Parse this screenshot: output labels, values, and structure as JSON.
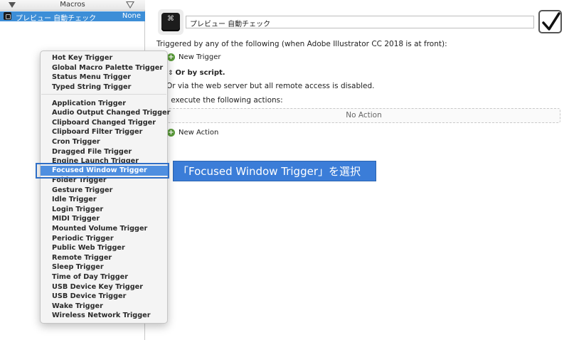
{
  "sidebar": {
    "header_title": "Macros",
    "macro": {
      "name": "プレビュー 自動チェック",
      "badge": "None"
    }
  },
  "editor": {
    "macro_name": "プレビュー 自動チェック",
    "macro_icon_glyph": "⌘",
    "enabled_checked": true,
    "triggered_label": "Triggered by any of the following (when Adobe Illustrator CC 2018 is at front):",
    "new_trigger": "New Trigger",
    "or_by_script": "Or by script.",
    "web_server": "Or via the web server but all remote access is disabled.",
    "execute_label": "Will execute the following actions:",
    "execute_label_visible": "l execute the following actions:",
    "no_action": "No Action",
    "new_action": "New Action"
  },
  "trigger_menu": {
    "group1": [
      "Hot Key Trigger",
      "Global Macro Palette Trigger",
      "Status Menu Trigger",
      "Typed String Trigger"
    ],
    "group2": [
      "Application Trigger",
      "Audio Output Changed Trigger",
      "Clipboard Changed Trigger",
      "Clipboard Filter Trigger",
      "Cron Trigger",
      "Dragged File Trigger",
      "Engine Launch Trigger",
      "Focused Window Trigger",
      "Folder Trigger",
      "Gesture Trigger",
      "Idle Trigger",
      "Login Trigger",
      "MIDI Trigger",
      "Mounted Volume Trigger",
      "Periodic Trigger",
      "Public Web Trigger",
      "Remote Trigger",
      "Sleep Trigger",
      "Time of Day Trigger",
      "USB Device Key Trigger",
      "USB Device Trigger",
      "Wake Trigger",
      "Wireless Network Trigger"
    ],
    "selected": "Focused Window Trigger"
  },
  "callout": {
    "text": "「Focused Window Trigger」を選択"
  },
  "colors": {
    "selection_blue": "#3d8ed7",
    "callout_blue": "#3b7dd8",
    "plus_green": "#5a9a3a"
  }
}
